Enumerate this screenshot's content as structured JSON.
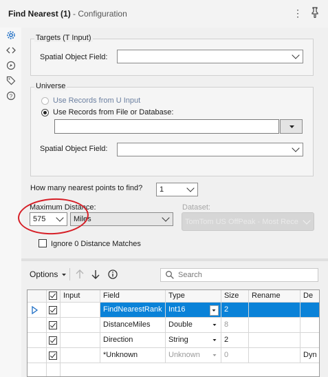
{
  "window": {
    "title": "Find Nearest (1)",
    "subtitle": "- Configuration",
    "more_icon": "vertical-ellipsis-icon",
    "pin_icon": "pin-icon"
  },
  "sidebar": {
    "items": [
      {
        "name": "settings",
        "icon": "gear-icon",
        "active": true
      },
      {
        "name": "xml",
        "icon": "code-icon"
      },
      {
        "name": "annotation",
        "icon": "annotation-icon"
      },
      {
        "name": "metadata",
        "icon": "tag-icon"
      },
      {
        "name": "help",
        "icon": "help-icon"
      }
    ]
  },
  "targets": {
    "legend": "Targets (T Input)",
    "spatial_label": "Spatial Object Field:",
    "spatial_value": ""
  },
  "universe": {
    "legend": "Universe",
    "option_u_input": "Use Records from U Input",
    "option_file_db": "Use Records from File or Database:",
    "selected_option": "Use Records from File or Database:",
    "file_path": "",
    "spatial_label": "Spatial Object Field:",
    "spatial_value": ""
  },
  "nearest": {
    "label": "How many nearest points to find?",
    "value": "1"
  },
  "max_distance": {
    "label": "Maximum Distance:",
    "value": "575",
    "unit": "Miles"
  },
  "dataset": {
    "label": "Dataset:",
    "value": "TomTom US OffPeak - Most Rece"
  },
  "ignore_zero": {
    "label": "Ignore 0 Distance Matches",
    "checked": false
  },
  "field_grid": {
    "options_label": "Options",
    "search_placeholder": "Search",
    "columns": [
      "Input",
      "Field",
      "Type",
      "Size",
      "Rename",
      "De"
    ],
    "rows": [
      {
        "checked": true,
        "input": "",
        "field": "FindNearestRank",
        "type": "Int16",
        "size": "2",
        "rename": "",
        "desc": "",
        "selected": true
      },
      {
        "checked": true,
        "input": "",
        "field": "DistanceMiles",
        "type": "Double",
        "size": "8",
        "rename": "",
        "desc": ""
      },
      {
        "checked": true,
        "input": "",
        "field": "Direction",
        "type": "String",
        "size": "2",
        "rename": "",
        "desc": ""
      },
      {
        "checked": true,
        "input": "",
        "field": "*Unknown",
        "type": "Unknown",
        "size": "0",
        "rename": "",
        "desc": "Dyn"
      }
    ]
  },
  "colors": {
    "accent": "#0a82d8",
    "highlight_circle": "#d61e26"
  }
}
